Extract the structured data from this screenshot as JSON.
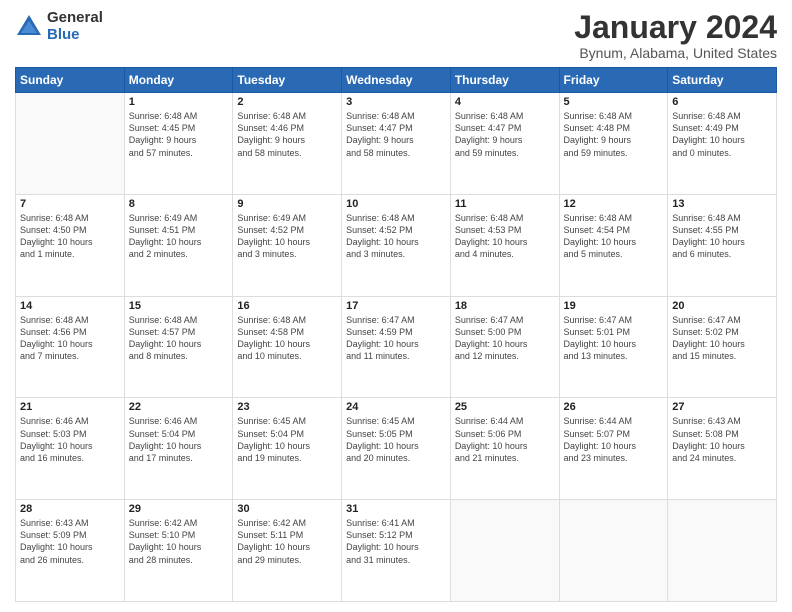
{
  "logo": {
    "general": "General",
    "blue": "Blue"
  },
  "header": {
    "month": "January 2024",
    "location": "Bynum, Alabama, United States"
  },
  "days_of_week": [
    "Sunday",
    "Monday",
    "Tuesday",
    "Wednesday",
    "Thursday",
    "Friday",
    "Saturday"
  ],
  "weeks": [
    [
      {
        "day": "",
        "info": ""
      },
      {
        "day": "1",
        "info": "Sunrise: 6:48 AM\nSunset: 4:45 PM\nDaylight: 9 hours\nand 57 minutes."
      },
      {
        "day": "2",
        "info": "Sunrise: 6:48 AM\nSunset: 4:46 PM\nDaylight: 9 hours\nand 58 minutes."
      },
      {
        "day": "3",
        "info": "Sunrise: 6:48 AM\nSunset: 4:47 PM\nDaylight: 9 hours\nand 58 minutes."
      },
      {
        "day": "4",
        "info": "Sunrise: 6:48 AM\nSunset: 4:47 PM\nDaylight: 9 hours\nand 59 minutes."
      },
      {
        "day": "5",
        "info": "Sunrise: 6:48 AM\nSunset: 4:48 PM\nDaylight: 9 hours\nand 59 minutes."
      },
      {
        "day": "6",
        "info": "Sunrise: 6:48 AM\nSunset: 4:49 PM\nDaylight: 10 hours\nand 0 minutes."
      }
    ],
    [
      {
        "day": "7",
        "info": "Sunrise: 6:48 AM\nSunset: 4:50 PM\nDaylight: 10 hours\nand 1 minute."
      },
      {
        "day": "8",
        "info": "Sunrise: 6:49 AM\nSunset: 4:51 PM\nDaylight: 10 hours\nand 2 minutes."
      },
      {
        "day": "9",
        "info": "Sunrise: 6:49 AM\nSunset: 4:52 PM\nDaylight: 10 hours\nand 3 minutes."
      },
      {
        "day": "10",
        "info": "Sunrise: 6:48 AM\nSunset: 4:52 PM\nDaylight: 10 hours\nand 3 minutes."
      },
      {
        "day": "11",
        "info": "Sunrise: 6:48 AM\nSunset: 4:53 PM\nDaylight: 10 hours\nand 4 minutes."
      },
      {
        "day": "12",
        "info": "Sunrise: 6:48 AM\nSunset: 4:54 PM\nDaylight: 10 hours\nand 5 minutes."
      },
      {
        "day": "13",
        "info": "Sunrise: 6:48 AM\nSunset: 4:55 PM\nDaylight: 10 hours\nand 6 minutes."
      }
    ],
    [
      {
        "day": "14",
        "info": "Sunrise: 6:48 AM\nSunset: 4:56 PM\nDaylight: 10 hours\nand 7 minutes."
      },
      {
        "day": "15",
        "info": "Sunrise: 6:48 AM\nSunset: 4:57 PM\nDaylight: 10 hours\nand 8 minutes."
      },
      {
        "day": "16",
        "info": "Sunrise: 6:48 AM\nSunset: 4:58 PM\nDaylight: 10 hours\nand 10 minutes."
      },
      {
        "day": "17",
        "info": "Sunrise: 6:47 AM\nSunset: 4:59 PM\nDaylight: 10 hours\nand 11 minutes."
      },
      {
        "day": "18",
        "info": "Sunrise: 6:47 AM\nSunset: 5:00 PM\nDaylight: 10 hours\nand 12 minutes."
      },
      {
        "day": "19",
        "info": "Sunrise: 6:47 AM\nSunset: 5:01 PM\nDaylight: 10 hours\nand 13 minutes."
      },
      {
        "day": "20",
        "info": "Sunrise: 6:47 AM\nSunset: 5:02 PM\nDaylight: 10 hours\nand 15 minutes."
      }
    ],
    [
      {
        "day": "21",
        "info": "Sunrise: 6:46 AM\nSunset: 5:03 PM\nDaylight: 10 hours\nand 16 minutes."
      },
      {
        "day": "22",
        "info": "Sunrise: 6:46 AM\nSunset: 5:04 PM\nDaylight: 10 hours\nand 17 minutes."
      },
      {
        "day": "23",
        "info": "Sunrise: 6:45 AM\nSunset: 5:04 PM\nDaylight: 10 hours\nand 19 minutes."
      },
      {
        "day": "24",
        "info": "Sunrise: 6:45 AM\nSunset: 5:05 PM\nDaylight: 10 hours\nand 20 minutes."
      },
      {
        "day": "25",
        "info": "Sunrise: 6:44 AM\nSunset: 5:06 PM\nDaylight: 10 hours\nand 21 minutes."
      },
      {
        "day": "26",
        "info": "Sunrise: 6:44 AM\nSunset: 5:07 PM\nDaylight: 10 hours\nand 23 minutes."
      },
      {
        "day": "27",
        "info": "Sunrise: 6:43 AM\nSunset: 5:08 PM\nDaylight: 10 hours\nand 24 minutes."
      }
    ],
    [
      {
        "day": "28",
        "info": "Sunrise: 6:43 AM\nSunset: 5:09 PM\nDaylight: 10 hours\nand 26 minutes."
      },
      {
        "day": "29",
        "info": "Sunrise: 6:42 AM\nSunset: 5:10 PM\nDaylight: 10 hours\nand 28 minutes."
      },
      {
        "day": "30",
        "info": "Sunrise: 6:42 AM\nSunset: 5:11 PM\nDaylight: 10 hours\nand 29 minutes."
      },
      {
        "day": "31",
        "info": "Sunrise: 6:41 AM\nSunset: 5:12 PM\nDaylight: 10 hours\nand 31 minutes."
      },
      {
        "day": "",
        "info": ""
      },
      {
        "day": "",
        "info": ""
      },
      {
        "day": "",
        "info": ""
      }
    ]
  ]
}
